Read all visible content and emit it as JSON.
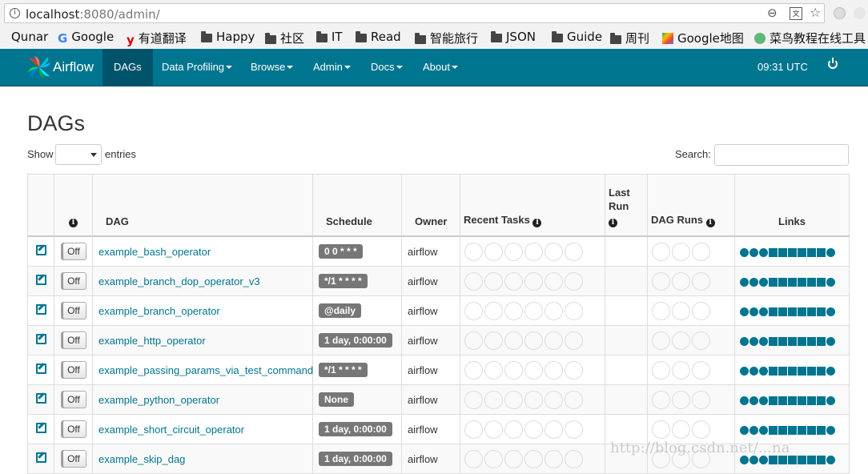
{
  "browser": {
    "url_host": "localhost",
    "url_rest": ":8080/admin/",
    "bookmarks": [
      {
        "label": "Qunar",
        "icon": "page-icon"
      },
      {
        "label": "Google",
        "icon": "google-icon"
      },
      {
        "label": "有道翻译",
        "icon": "youdao-icon"
      },
      {
        "label": "Happy",
        "icon": "folder-icon"
      },
      {
        "label": "社区",
        "icon": "folder-icon"
      },
      {
        "label": "IT",
        "icon": "folder-icon"
      },
      {
        "label": "Read",
        "icon": "folder-icon"
      },
      {
        "label": "智能旅行",
        "icon": "folder-icon"
      },
      {
        "label": "JSON",
        "icon": "folder-icon"
      },
      {
        "label": "Guide",
        "icon": "folder-icon"
      },
      {
        "label": "周刊",
        "icon": "folder-icon"
      },
      {
        "label": "Google地图",
        "icon": "maps-icon"
      },
      {
        "label": "菜鸟教程在线工具",
        "icon": "runoob-icon"
      }
    ]
  },
  "nav": {
    "brand": "Airflow",
    "items": [
      "DAGs",
      "Data Profiling",
      "Browse",
      "Admin",
      "Docs",
      "About"
    ],
    "time": "09:31 UTC"
  },
  "page": {
    "title": "DAGs",
    "show_label": "Show",
    "entries_label": "entries",
    "search_label": "Search:"
  },
  "table": {
    "headers": {
      "dag": "DAG",
      "schedule": "Schedule",
      "owner": "Owner",
      "recent_tasks": "Recent Tasks",
      "last_run": "Last Run",
      "dag_runs": "DAG Runs",
      "links": "Links"
    },
    "toggle_label": "Off",
    "rows": [
      {
        "dag": "example_bash_operator",
        "schedule": "0 0 * * *",
        "owner": "airflow"
      },
      {
        "dag": "example_branch_dop_operator_v3",
        "schedule": "*/1 * * * *",
        "owner": "airflow"
      },
      {
        "dag": "example_branch_operator",
        "schedule": "@daily",
        "owner": "airflow"
      },
      {
        "dag": "example_http_operator",
        "schedule": "1 day, 0:00:00",
        "owner": "airflow"
      },
      {
        "dag": "example_passing_params_via_test_command",
        "schedule": "*/1 * * * *",
        "owner": "airflow"
      },
      {
        "dag": "example_python_operator",
        "schedule": "None",
        "owner": "airflow"
      },
      {
        "dag": "example_short_circuit_operator",
        "schedule": "1 day, 0:00:00",
        "owner": "airflow"
      },
      {
        "dag": "example_skip_dag",
        "schedule": "1 day, 0:00:00",
        "owner": "airflow"
      }
    ]
  },
  "watermark": "http://blog.csdn.net/...na",
  "colors": {
    "nav": "#00758f",
    "link": "#00758f",
    "badge": "#777777"
  }
}
